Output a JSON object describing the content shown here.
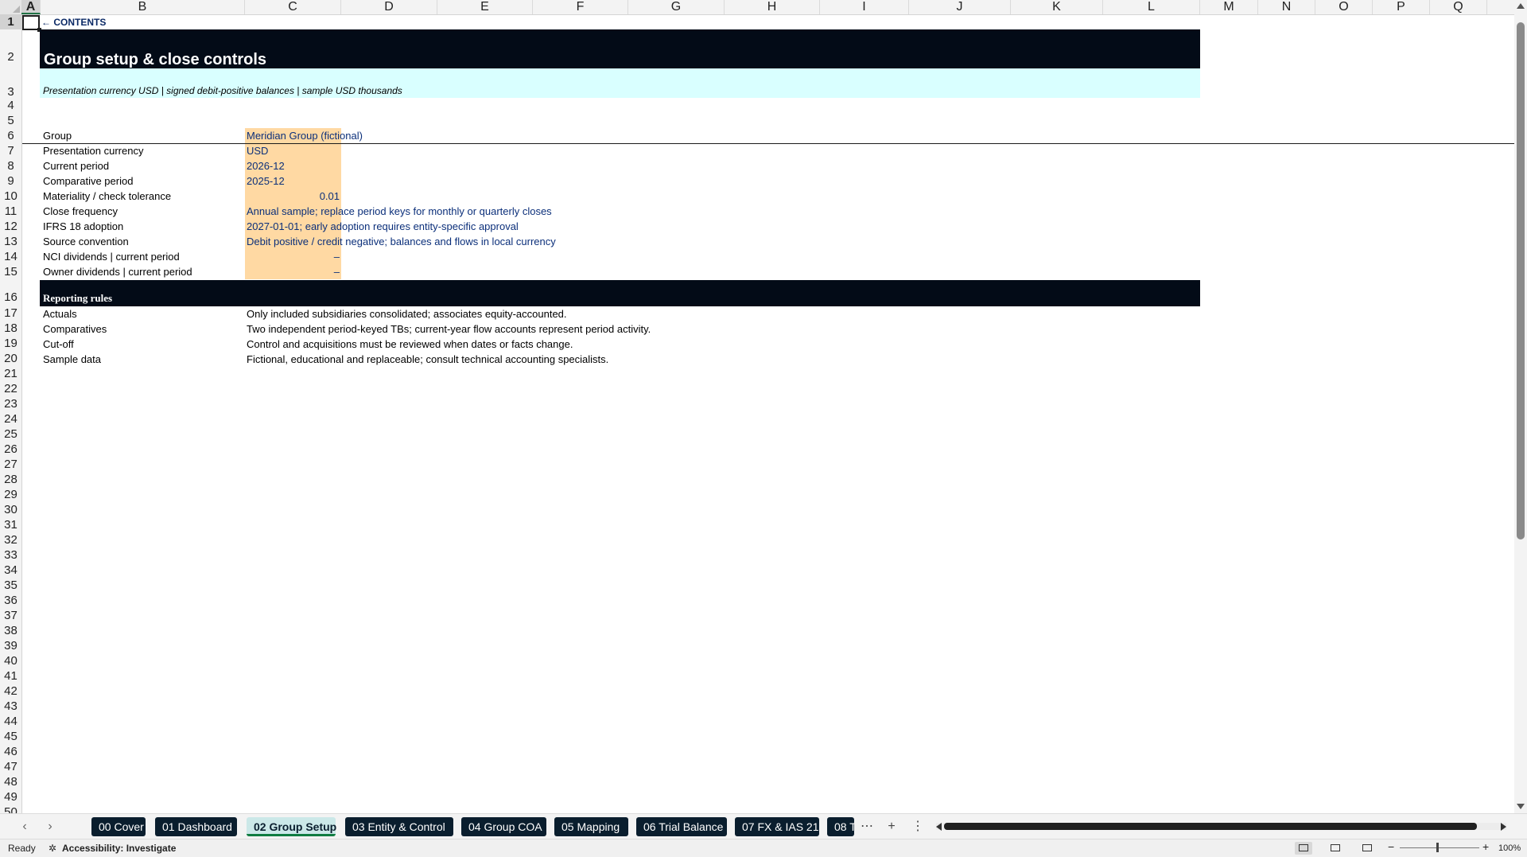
{
  "columns": [
    "A",
    "B",
    "C",
    "D",
    "E",
    "F",
    "G",
    "H",
    "I",
    "J",
    "K",
    "L",
    "M",
    "N",
    "O",
    "P",
    "Q"
  ],
  "selected_column": "A",
  "rows": [
    "1",
    "2",
    "3",
    "4",
    "5",
    "6",
    "7",
    "8",
    "9",
    "10",
    "11",
    "12",
    "13",
    "14",
    "15",
    "16",
    "17",
    "18",
    "19",
    "20",
    "21",
    "22",
    "23",
    "24",
    "25",
    "26",
    "27",
    "28",
    "29",
    "30",
    "31",
    "32",
    "33",
    "34",
    "35",
    "36",
    "37",
    "38",
    "39",
    "40",
    "41",
    "42",
    "43",
    "44",
    "45",
    "46",
    "47",
    "48",
    "49",
    "50"
  ],
  "selected_row": "1",
  "sheet": {
    "back_link": "← CONTENTS",
    "title": "Group setup & close controls",
    "subtitle": "Presentation currency USD | signed debit-positive balances | sample USD thousands",
    "setup": [
      {
        "label": "Group",
        "value": "Meridian Group (fictional)"
      },
      {
        "label": "Presentation currency",
        "value": "USD"
      },
      {
        "label": "Current period",
        "value": "2026-12"
      },
      {
        "label": "Comparative period",
        "value": "2025-12"
      },
      {
        "label": "Materiality / check tolerance",
        "value": "0.01"
      },
      {
        "label": "Close frequency",
        "value": "Annual sample; replace period keys for monthly or quarterly closes"
      },
      {
        "label": "IFRS 18 adoption",
        "value": "2027-01-01; early adoption requires entity-specific approval"
      },
      {
        "label": "Source convention",
        "value": "Debit positive / credit negative; balances and flows in local currency"
      },
      {
        "label": "NCI dividends | current period",
        "value": "–"
      },
      {
        "label": "Owner dividends | current period",
        "value": "–"
      }
    ],
    "rules_header": "Reporting rules",
    "rules": [
      {
        "label": "Actuals",
        "value": "Only included subsidiaries consolidated; associates equity-accounted."
      },
      {
        "label": "Comparatives",
        "value": "Two independent period-keyed TBs; current-year flow accounts represent period activity."
      },
      {
        "label": "Cut-off",
        "value": "Control and acquisitions must be reviewed when dates or facts change."
      },
      {
        "label": "Sample data",
        "value": "Fictional, educational and replaceable; consult technical accounting specialists."
      }
    ]
  },
  "tabs": [
    "00 Cover",
    "01 Dashboard",
    "02 Group Setup",
    "03 Entity & Control",
    "04 Group COA",
    "05 Mapping",
    "06 Trial Balance",
    "07 FX & IAS 21",
    "08 T"
  ],
  "active_tab": "02 Group Setup",
  "tab_tools": {
    "more": "⋯",
    "add": "+",
    "options": "⋮",
    "prev": "‹",
    "next": "›"
  },
  "status": {
    "ready": "Ready",
    "accessibility": "Accessibility: Investigate",
    "zoom_minus": "−",
    "zoom_plus": "+",
    "zoom": "100%"
  },
  "colors": {
    "title_bar": "#030b17",
    "subtitle_bar": "#d9ffff",
    "input_fill": "#ffd9a3",
    "input_text": "#0b2f7a",
    "active_tab_accent": "#107c41"
  }
}
